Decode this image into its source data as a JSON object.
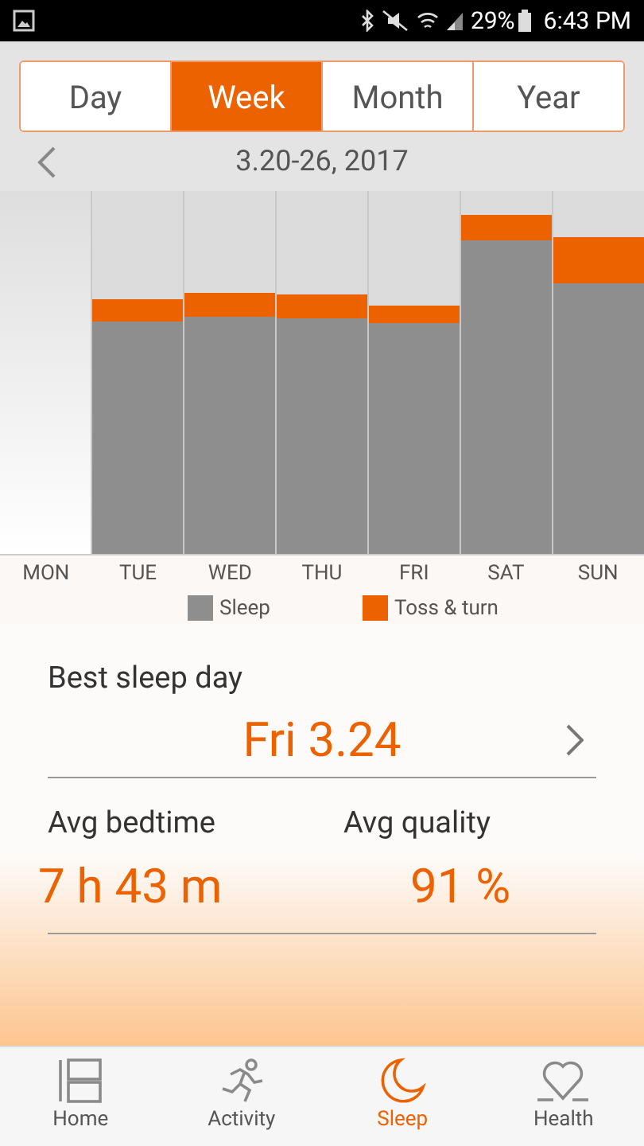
{
  "status_bar": {
    "battery": "29%",
    "time": "6:43 PM"
  },
  "tabs": [
    {
      "label": "Day",
      "selected": false
    },
    {
      "label": "Week",
      "selected": true
    },
    {
      "label": "Month",
      "selected": false
    },
    {
      "label": "Year",
      "selected": false
    }
  ],
  "date_range": "3.20-26, 2017",
  "chart": {
    "days": [
      "MON",
      "TUE",
      "WED",
      "THU",
      "FRI",
      "SAT",
      "SUN"
    ],
    "legend": [
      {
        "label": "Sleep",
        "color": "#8e8e8e"
      },
      {
        "label": "Toss & turn",
        "color": "#ec6200"
      }
    ]
  },
  "best_sleep_day": {
    "label": "Best sleep day",
    "value": "Fri 3.24"
  },
  "stats": [
    {
      "label": "Avg bedtime",
      "value": "7 h 43 m"
    },
    {
      "label": "Avg quality",
      "value": "91 %"
    }
  ],
  "nav": [
    {
      "label": "Home",
      "selected": false
    },
    {
      "label": "Activity",
      "selected": false
    },
    {
      "label": "Sleep",
      "selected": true
    },
    {
      "label": "Health",
      "selected": false
    }
  ]
}
